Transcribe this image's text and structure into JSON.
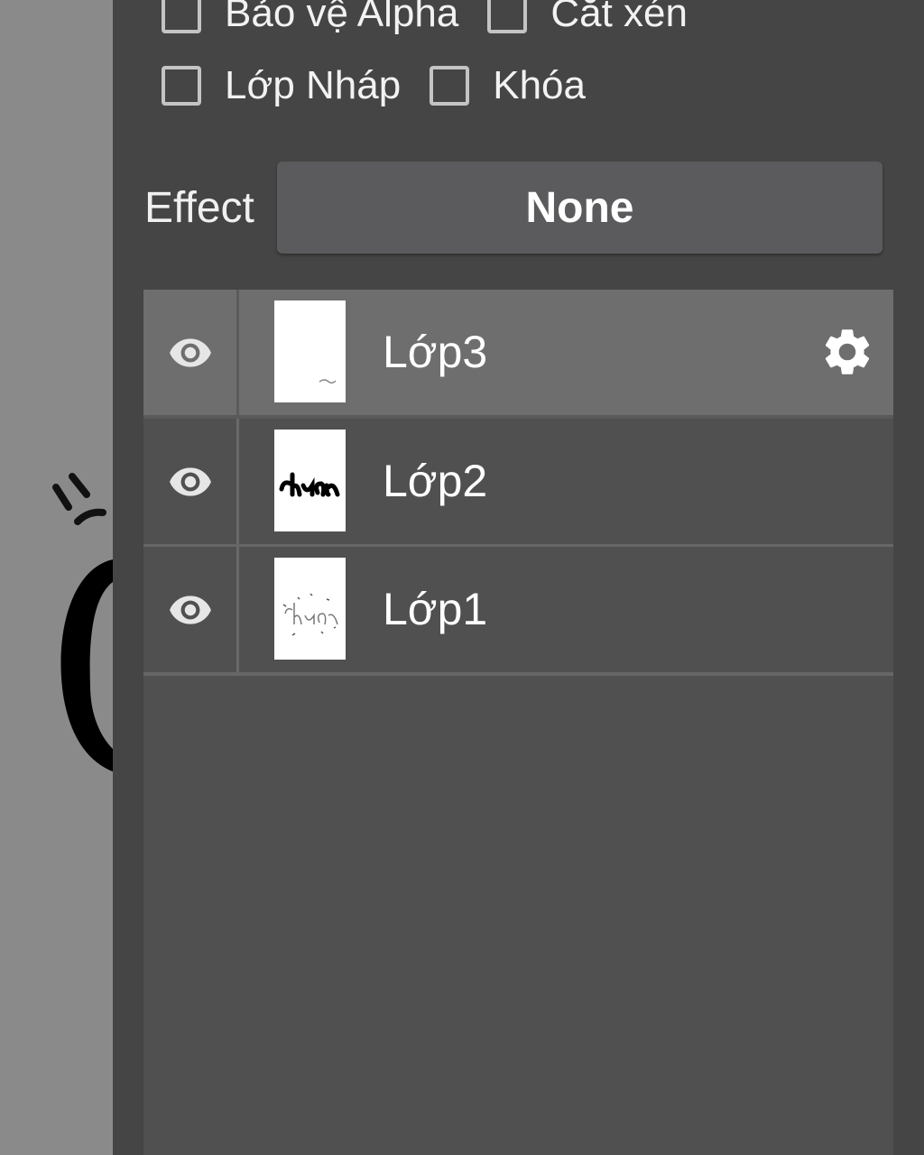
{
  "layer_options": {
    "checkboxes_row1": [
      {
        "label": "Bảo vệ Alpha",
        "checked": false
      },
      {
        "label": "Cắt xén",
        "checked": false
      }
    ],
    "checkboxes_row2": [
      {
        "label": "Lớp Nháp",
        "checked": false
      },
      {
        "label": "Khóa",
        "checked": false
      }
    ],
    "effect_label": "Effect",
    "effect_value": "None"
  },
  "layers": [
    {
      "name": "Lớp3",
      "visible": true,
      "selected": true,
      "thumbnail": "mostly-blank"
    },
    {
      "name": "Lớp2",
      "visible": true,
      "selected": false,
      "thumbnail": "bold-lettering"
    },
    {
      "name": "Lớp1",
      "visible": true,
      "selected": false,
      "thumbnail": "outlined-lettering"
    }
  ],
  "icons": {
    "visibility": "eye-icon",
    "settings": "gear-icon"
  },
  "colors": {
    "panel_bg": "#454545",
    "list_bg": "#505050",
    "selected_row": "#6e6e6e",
    "button_bg": "#5b5b5d",
    "canvas_bg": "#8a8a8a"
  }
}
